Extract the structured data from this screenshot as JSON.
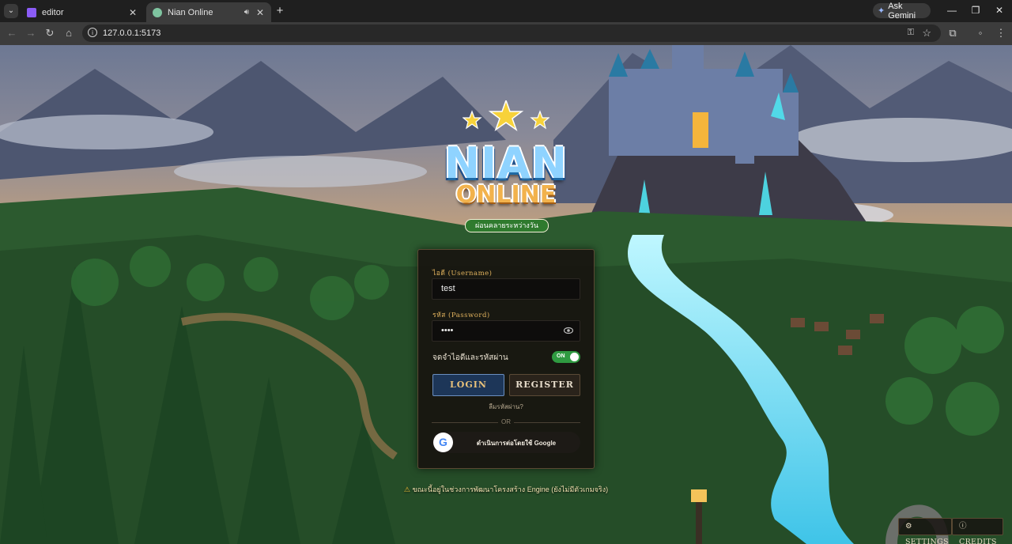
{
  "browser": {
    "tabs": [
      {
        "title": "editor",
        "active": false
      },
      {
        "title": "Nian Online",
        "active": true
      }
    ],
    "ask_gemini": "Ask Gemini",
    "url": "127.0.0.1:5173"
  },
  "logo": {
    "title": "NIAN",
    "subtitle": "ONLINE",
    "tagline": "ผ่อนคลายระหว่างวัน"
  },
  "login": {
    "username_label": "ไอดี (Username)",
    "username_value": "test",
    "password_label": "รหัส (Password)",
    "password_value": "••••",
    "remember_label": "จดจำไอดีและรหัสผ่าน",
    "toggle_state": "ON",
    "login_button": "LOGIN",
    "register_button": "REGISTER",
    "forgot": "ลืมรหัสผ่าน?",
    "or": "OR",
    "google_button": "ดำเนินการต่อโดยใช้ Google"
  },
  "notice": "ขณะนี้อยู่ในช่วงการพัฒนาโครงสร้าง Engine (ยังไม่มีตัวเกมจริง)",
  "corner": {
    "settings": "SETTINGS",
    "credits": "CREDITS"
  },
  "colors": {
    "accent_gold": "#e2b35e",
    "login_blue": "#1d3658",
    "toggle_green": "#2f9a41"
  }
}
